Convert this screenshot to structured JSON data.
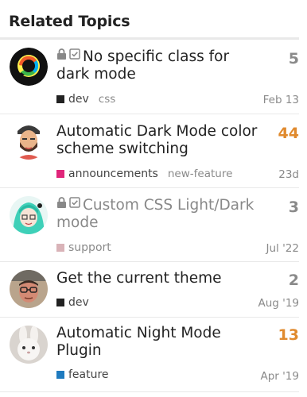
{
  "section_title": "Related Topics",
  "topics": [
    {
      "title": "No specific class for dark mode",
      "locked": true,
      "solved": true,
      "count": "5",
      "count_hot": false,
      "category": "dev",
      "category_color": "#222222",
      "tag": "css",
      "date": "Feb 13",
      "avatar": "discourse-logo"
    },
    {
      "title": "Automatic Dark Mode color scheme switching",
      "locked": false,
      "solved": false,
      "count": "44",
      "count_hot": true,
      "category": "announcements",
      "category_color": "#e0257a",
      "tag": "new-feature",
      "date": "23d",
      "avatar": "person-beard-cap"
    },
    {
      "title": "Custom CSS Light/Dark mode",
      "locked": true,
      "solved": true,
      "count": "3",
      "count_hot": false,
      "category": "support",
      "category_color": "#d9b3b8",
      "tag": "",
      "date": "Jul '22",
      "avatar": "anime-character"
    },
    {
      "title": "Get the current theme",
      "locked": false,
      "solved": false,
      "count": "2",
      "count_hot": false,
      "category": "dev",
      "category_color": "#222222",
      "tag": "",
      "date": "Aug '19",
      "avatar": "person-glasses"
    },
    {
      "title": "Automatic Night Mode Plugin",
      "locked": false,
      "solved": false,
      "count": "13",
      "count_hot": true,
      "category": "feature",
      "category_color": "#1f7bbf",
      "tag": "",
      "date": "Apr '19",
      "avatar": "rabbit"
    }
  ]
}
